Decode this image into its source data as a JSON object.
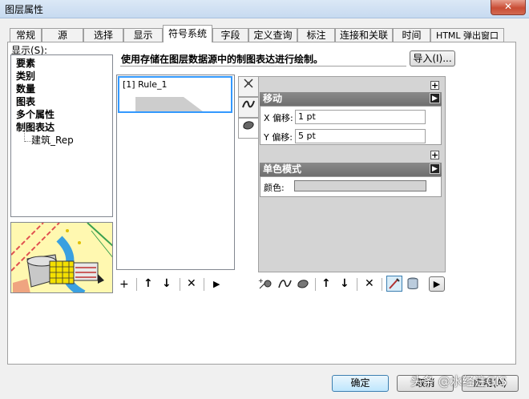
{
  "window": {
    "title": "图层属性",
    "close_label": "✕"
  },
  "tabs": [
    "常规",
    "源",
    "选择",
    "显示",
    "符号系统",
    "字段",
    "定义查询",
    "标注",
    "连接和关联",
    "时间",
    "HTML 弹出窗口"
  ],
  "active_tab": "符号系统",
  "show": {
    "label": "显示(S):",
    "items": [
      "要素",
      "类别",
      "数量",
      "图表",
      "多个属性",
      "制图表达"
    ],
    "subitem": "建筑_Rep"
  },
  "description": "使用存储在图层数据源中的制图表达进行绘制。",
  "import_button": "导入(I)...",
  "rules": [
    {
      "label": "[1] Rule_1"
    }
  ],
  "rule_toolbar": {
    "add": "+",
    "up": "↑",
    "down": "↓",
    "delete": "✕",
    "more": "▶"
  },
  "groups": {
    "move": {
      "title": "移动",
      "x_label": "X 偏移:",
      "x_value": "1 pt",
      "y_label": "Y 偏移:",
      "y_value": "5 pt"
    },
    "fill": {
      "title": "单色模式",
      "color_label": "颜色:",
      "color_value": "#d3d3d3"
    }
  },
  "buttons": {
    "ok": "确定",
    "cancel": "取消",
    "apply": "应用(A)"
  },
  "watermark": "头条 @水经注GIS"
}
